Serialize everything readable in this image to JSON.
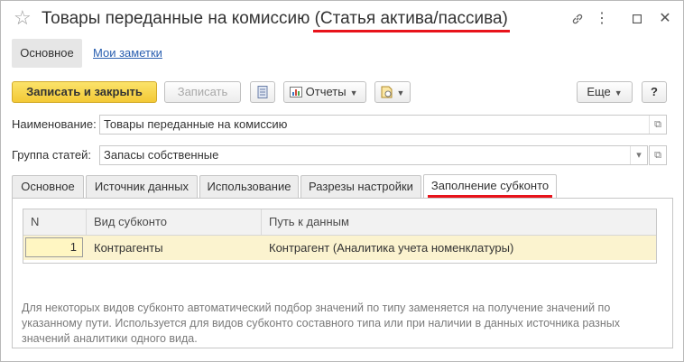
{
  "window": {
    "title_main": "Товары переданные на комиссию ",
    "title_sub": "(Статья актива/пассива)",
    "controls": {
      "link": "🔗",
      "more": "⋮",
      "maximize": "☐",
      "close": "✕"
    }
  },
  "nav": {
    "main": "Основное",
    "notes": "Мои заметки"
  },
  "toolbar": {
    "save_close": "Записать и закрыть",
    "save": "Записать",
    "reports": "Отчеты",
    "more": "Еще",
    "help": "?"
  },
  "form": {
    "name_label": "Наименование:",
    "name_value": "Товары переданные на комиссию",
    "group_label": "Группа статей:",
    "group_value": "Запасы собственные"
  },
  "tabs": [
    "Основное",
    "Источник данных",
    "Использование",
    "Разрезы настройки",
    "Заполнение субконто"
  ],
  "table": {
    "headers": [
      "N",
      "Вид субконто",
      "Путь к данным"
    ],
    "rows": [
      {
        "n": "1",
        "kind": "Контрагенты",
        "path": "Контрагент (Аналитика учета номенклатуры)"
      }
    ]
  },
  "hint": "Для некоторых видов субконто автоматический подбор значений по типу заменяется на получение значений по указанному пути. Используется для видов субконто составного типа или при наличии в данных источника разных значений аналитики одного вида."
}
